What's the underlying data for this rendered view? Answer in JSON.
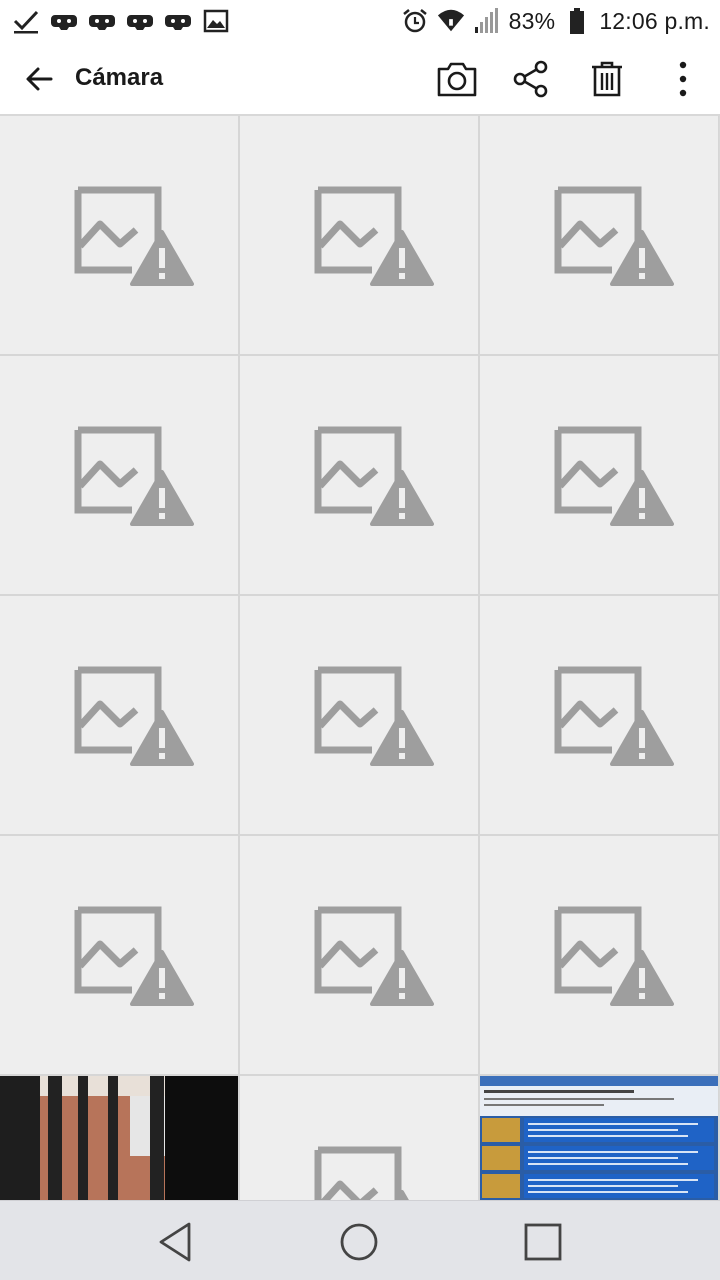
{
  "status_bar": {
    "battery_percent": "83%",
    "time": "12:06 p.m.",
    "icons": [
      "check-icon",
      "game-controller-icon",
      "game-controller-icon",
      "game-controller-icon",
      "game-controller-icon",
      "image-icon",
      "alarm-icon",
      "wifi-icon",
      "signal-icon",
      "battery-icon"
    ]
  },
  "app_bar": {
    "title": "Cámara",
    "actions": [
      "back-arrow-icon",
      "camera-icon",
      "share-icon",
      "delete-icon",
      "more-vert-icon"
    ]
  },
  "grid": {
    "columns": 3,
    "tiles": [
      {
        "kind": "broken-image"
      },
      {
        "kind": "broken-image"
      },
      {
        "kind": "broken-image"
      },
      {
        "kind": "broken-image"
      },
      {
        "kind": "broken-image"
      },
      {
        "kind": "broken-image"
      },
      {
        "kind": "broken-image"
      },
      {
        "kind": "broken-image"
      },
      {
        "kind": "broken-image"
      },
      {
        "kind": "broken-image"
      },
      {
        "kind": "broken-image"
      },
      {
        "kind": "broken-image"
      },
      {
        "kind": "photo-window"
      },
      {
        "kind": "broken-image"
      },
      {
        "kind": "photo-screenshot"
      }
    ]
  },
  "nav_bar": {
    "buttons": [
      "nav-back-icon",
      "nav-home-icon",
      "nav-recent-icon"
    ]
  },
  "colors": {
    "placeholder_bg": "#eeeeee",
    "placeholder_icon": "#9e9e9e",
    "nav_bg": "#e3e4e8",
    "text": "#1a1a1a"
  }
}
